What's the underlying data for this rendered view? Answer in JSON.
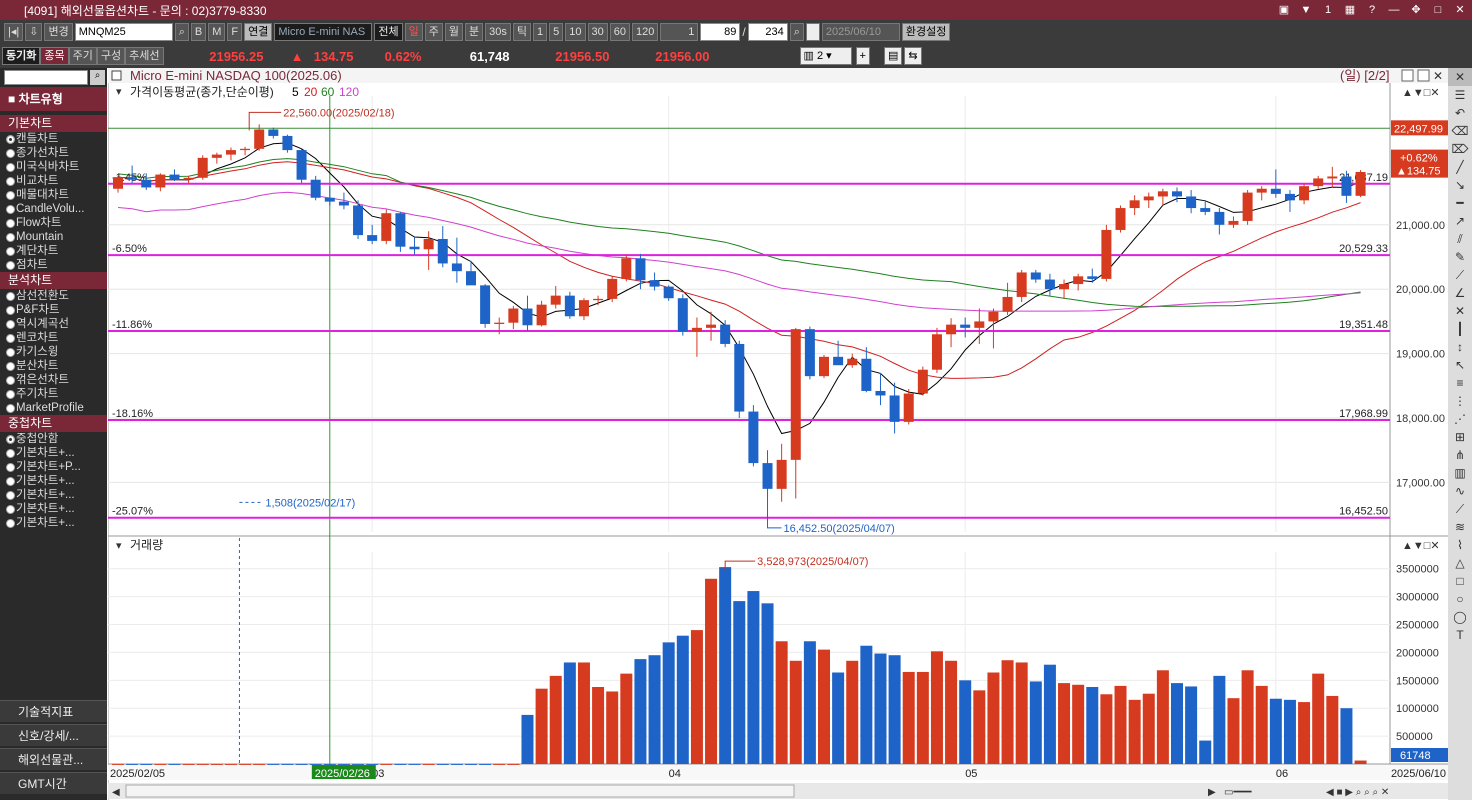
{
  "window": {
    "title": "[4091] 해외선물옵션차트 - 문의 : 02)3779-8330"
  },
  "toolbar1": {
    "mode": "변경",
    "symbol": "MNQM25",
    "btn_b": "B",
    "btn_m": "M",
    "btn_f": "F",
    "connect": "연결",
    "name": "Micro E-mini NAS",
    "all": "전체",
    "periods": [
      "일",
      "주",
      "월",
      "분",
      "30s",
      "틱"
    ],
    "nums": [
      "1",
      "5",
      "10",
      "30",
      "60",
      "120"
    ],
    "unit": "1",
    "count": "89",
    "total": "234",
    "date": "2025/06/10",
    "settings": "환경설정"
  },
  "toolbar2": {
    "sync": "동기화",
    "tabs": [
      "종목",
      "주기",
      "구성",
      "추세선"
    ],
    "price": "21956.25",
    "arrow": "▲",
    "change": "134.75",
    "pct": "0.62%",
    "volume": "61,748",
    "bid": "21956.50",
    "ask": "21956.00",
    "layout": "2"
  },
  "sidebar": {
    "header": "차트유형",
    "sections": [
      {
        "title": "기본차트",
        "items": [
          "캔들차트",
          "종가선차트",
          "미국식바차트",
          "비교차트",
          "매물대차트",
          "CandleVolu...",
          "Flow차트",
          "Mountain",
          "계단차트",
          "점차트"
        ]
      },
      {
        "title": "분석차트",
        "items": [
          "삼선전환도",
          "P&F차트",
          "역시계곡선",
          "렌코차트",
          "카기스윙",
          "분산차트",
          "꺾은선차트",
          "주기차트",
          "MarketProfile"
        ]
      },
      {
        "title": "중첩차트",
        "items": [
          "중첩안함",
          "기본차트+...",
          "기본차트+P...",
          "기본차트+...",
          "기본차트+...",
          "기본차트+...",
          "기본차트+..."
        ]
      }
    ],
    "footer": [
      "기술적지표",
      "신호/강세/...",
      "해외선물관...",
      "GMT시간"
    ]
  },
  "chart_data": {
    "type": "candlestick",
    "title": "Micro E-mini NASDAQ 100(2025.06)",
    "period_label": "(일) [2/2]",
    "ma_label": "가격이동평균(종가,단순이평)",
    "ma_periods": [
      "5",
      "20",
      "60",
      "120"
    ],
    "ma_colors": [
      "#000000",
      "#d02020",
      "#208020",
      "#d040d0"
    ],
    "ylim": [
      16230,
      23000
    ],
    "yticks": [
      17000,
      18000,
      19000,
      20000,
      21000
    ],
    "price_labels": {
      "current": "22,497.99",
      "chg_pct": "+0.62%",
      "chg": "▲134.75"
    },
    "levels": [
      {
        "pct": "-1.45%",
        "price": "21,637.19",
        "value": 21637
      },
      {
        "pct": "-6.50%",
        "price": "20,529.33",
        "value": 20529
      },
      {
        "pct": "-11.86%",
        "price": "19,351.48",
        "value": 19351
      },
      {
        "pct": "-18.16%",
        "price": "17,968.99",
        "value": 17969
      },
      {
        "pct": "-25.07%",
        "price": "16,452.50",
        "value": 16452
      }
    ],
    "top_line": 22500,
    "high_note": "22,560.00(2025/02/18)",
    "low_note": "16,452.50(2025/04/07)",
    "xticks": [
      {
        "i": 0,
        "label": "2025/02/05"
      },
      {
        "i": 18,
        "label": "03"
      },
      {
        "i": 39,
        "label": "04"
      },
      {
        "i": 60,
        "label": "05"
      },
      {
        "i": 82,
        "label": "06"
      },
      {
        "i": 88,
        "label": "2025/06/10"
      }
    ],
    "selected_date": {
      "i": 15,
      "label": "2025/02/26"
    },
    "candles": [
      [
        21560,
        21760,
        21500,
        21740
      ],
      [
        21740,
        21920,
        21650,
        21700
      ],
      [
        21700,
        21800,
        21540,
        21580
      ],
      [
        21580,
        21800,
        21520,
        21780
      ],
      [
        21780,
        21860,
        21680,
        21700
      ],
      [
        21700,
        21760,
        21640,
        21730
      ],
      [
        21730,
        22080,
        21700,
        22040
      ],
      [
        22040,
        22120,
        21950,
        22090
      ],
      [
        22090,
        22200,
        22000,
        22160
      ],
      [
        22160,
        22210,
        22080,
        22180
      ],
      [
        22180,
        22560,
        22150,
        22480
      ],
      [
        22480,
        22510,
        22340,
        22380
      ],
      [
        22380,
        22400,
        22120,
        22160
      ],
      [
        22160,
        22180,
        21650,
        21700
      ],
      [
        21700,
        21760,
        21380,
        21420
      ],
      [
        21420,
        21600,
        21300,
        21360
      ],
      [
        21360,
        21500,
        21240,
        21300
      ],
      [
        21300,
        21380,
        20780,
        20840
      ],
      [
        20840,
        21000,
        20700,
        20750
      ],
      [
        20750,
        21240,
        20700,
        21180
      ],
      [
        21180,
        21200,
        20580,
        20660
      ],
      [
        20660,
        20800,
        20540,
        20620
      ],
      [
        20620,
        20900,
        20300,
        20780
      ],
      [
        20780,
        20980,
        20340,
        20400
      ],
      [
        20400,
        20800,
        20100,
        20280
      ],
      [
        20280,
        20440,
        20100,
        20060
      ],
      [
        20060,
        20080,
        19400,
        19460
      ],
      [
        19460,
        19560,
        19300,
        19480
      ],
      [
        19480,
        19740,
        19380,
        19700
      ],
      [
        19700,
        19900,
        19350,
        19440
      ],
      [
        19440,
        19820,
        19420,
        19760
      ],
      [
        19760,
        20050,
        19700,
        19900
      ],
      [
        19900,
        19960,
        19540,
        19580
      ],
      [
        19580,
        19860,
        19520,
        19830
      ],
      [
        19830,
        19900,
        19750,
        19850
      ],
      [
        19850,
        20200,
        19800,
        20160
      ],
      [
        20160,
        20540,
        20120,
        20480
      ],
      [
        20480,
        20550,
        20000,
        20140
      ],
      [
        20140,
        20260,
        19980,
        20040
      ],
      [
        20040,
        20060,
        19820,
        19860
      ],
      [
        19860,
        19920,
        19280,
        19340
      ],
      [
        19340,
        19560,
        18950,
        19400
      ],
      [
        19400,
        19650,
        19200,
        19450
      ],
      [
        19450,
        19520,
        19100,
        19150
      ],
      [
        19150,
        19200,
        18000,
        18100
      ],
      [
        18100,
        18200,
        17250,
        17300
      ],
      [
        17300,
        17500,
        16450,
        16900
      ],
      [
        16900,
        17600,
        16700,
        17350
      ],
      [
        17350,
        19400,
        16750,
        19380
      ],
      [
        19380,
        19420,
        18600,
        18650
      ],
      [
        18650,
        18980,
        18620,
        18950
      ],
      [
        18950,
        19200,
        18840,
        18820
      ],
      [
        18820,
        19000,
        18780,
        18920
      ],
      [
        18920,
        19100,
        18400,
        18420
      ],
      [
        18420,
        18700,
        18200,
        18350
      ],
      [
        18350,
        18550,
        17760,
        17940
      ],
      [
        17940,
        18450,
        17900,
        18380
      ],
      [
        18380,
        18800,
        18350,
        18750
      ],
      [
        18750,
        19400,
        18700,
        19300
      ],
      [
        19300,
        19550,
        19100,
        19450
      ],
      [
        19450,
        19560,
        19250,
        19400
      ],
      [
        19400,
        19700,
        19150,
        19500
      ],
      [
        19500,
        19700,
        19080,
        19650
      ],
      [
        19650,
        20100,
        19600,
        19880
      ],
      [
        19880,
        20300,
        19800,
        20260
      ],
      [
        20260,
        20300,
        20100,
        20150
      ],
      [
        20150,
        20240,
        19900,
        20000
      ],
      [
        20000,
        20150,
        19850,
        20080
      ],
      [
        20080,
        20240,
        19980,
        20200
      ],
      [
        20200,
        20320,
        20100,
        20160
      ],
      [
        20160,
        21000,
        20120,
        20920
      ],
      [
        20920,
        21300,
        20880,
        21260
      ],
      [
        21260,
        21460,
        21150,
        21380
      ],
      [
        21380,
        21500,
        21260,
        21440
      ],
      [
        21440,
        21560,
        21300,
        21520
      ],
      [
        21520,
        21580,
        21350,
        21440
      ],
      [
        21440,
        21540,
        21180,
        21260
      ],
      [
        21260,
        21360,
        21150,
        21200
      ],
      [
        21200,
        21260,
        20850,
        21000
      ],
      [
        21000,
        21130,
        20950,
        21060
      ],
      [
        21060,
        21540,
        21000,
        21500
      ],
      [
        21500,
        21600,
        21380,
        21560
      ],
      [
        21560,
        21860,
        21420,
        21480
      ],
      [
        21480,
        21540,
        21200,
        21380
      ],
      [
        21380,
        21640,
        21320,
        21600
      ],
      [
        21600,
        21760,
        21560,
        21720
      ],
      [
        21720,
        21900,
        21580,
        21750
      ],
      [
        21750,
        21840,
        21340,
        21450
      ],
      [
        21450,
        21850,
        21430,
        21820
      ]
    ],
    "volume": {
      "title": "거래량",
      "ylim": [
        0,
        3800000
      ],
      "yticks": [
        500000,
        1000000,
        1500000,
        2000000,
        2500000,
        3000000,
        3500000
      ],
      "ytick_labels": [
        "500000",
        "1000000",
        "1500000",
        "2000000",
        "2500000",
        "3000000",
        "3500000"
      ],
      "last_label": "61748",
      "peak_note": "3,528,973(2025/04/07)",
      "early_note": "1,508(2025/02/17)",
      "values": [
        1508,
        1508,
        1508,
        1508,
        1508,
        1508,
        1508,
        1508,
        1508,
        1508,
        1508,
        1508,
        1508,
        1508,
        1508,
        1508,
        1508,
        1508,
        1508,
        1508,
        1508,
        1508,
        1508,
        1508,
        1508,
        1508,
        1508,
        1508,
        1508,
        880000,
        1350000,
        1580000,
        1820000,
        1820000,
        1380000,
        1300000,
        1620000,
        1880000,
        1950000,
        2180000,
        2300000,
        2400000,
        3320000,
        3528973,
        2920000,
        3100000,
        2880000,
        2200000,
        1850000,
        2200000,
        2050000,
        1640000,
        1850000,
        2120000,
        1980000,
        1950000,
        1650000,
        1650000,
        2020000,
        1850000,
        1500000,
        1320000,
        1640000,
        1860000,
        1820000,
        1480000,
        1780000,
        1450000,
        1420000,
        1380000,
        1250000,
        1400000,
        1150000,
        1260000,
        1680000,
        1450000,
        1390000,
        420000,
        1580000,
        1180000,
        1680000,
        1400000,
        1170000,
        1150000,
        1110000,
        1620000,
        1220000,
        1000000,
        61748
      ]
    }
  }
}
